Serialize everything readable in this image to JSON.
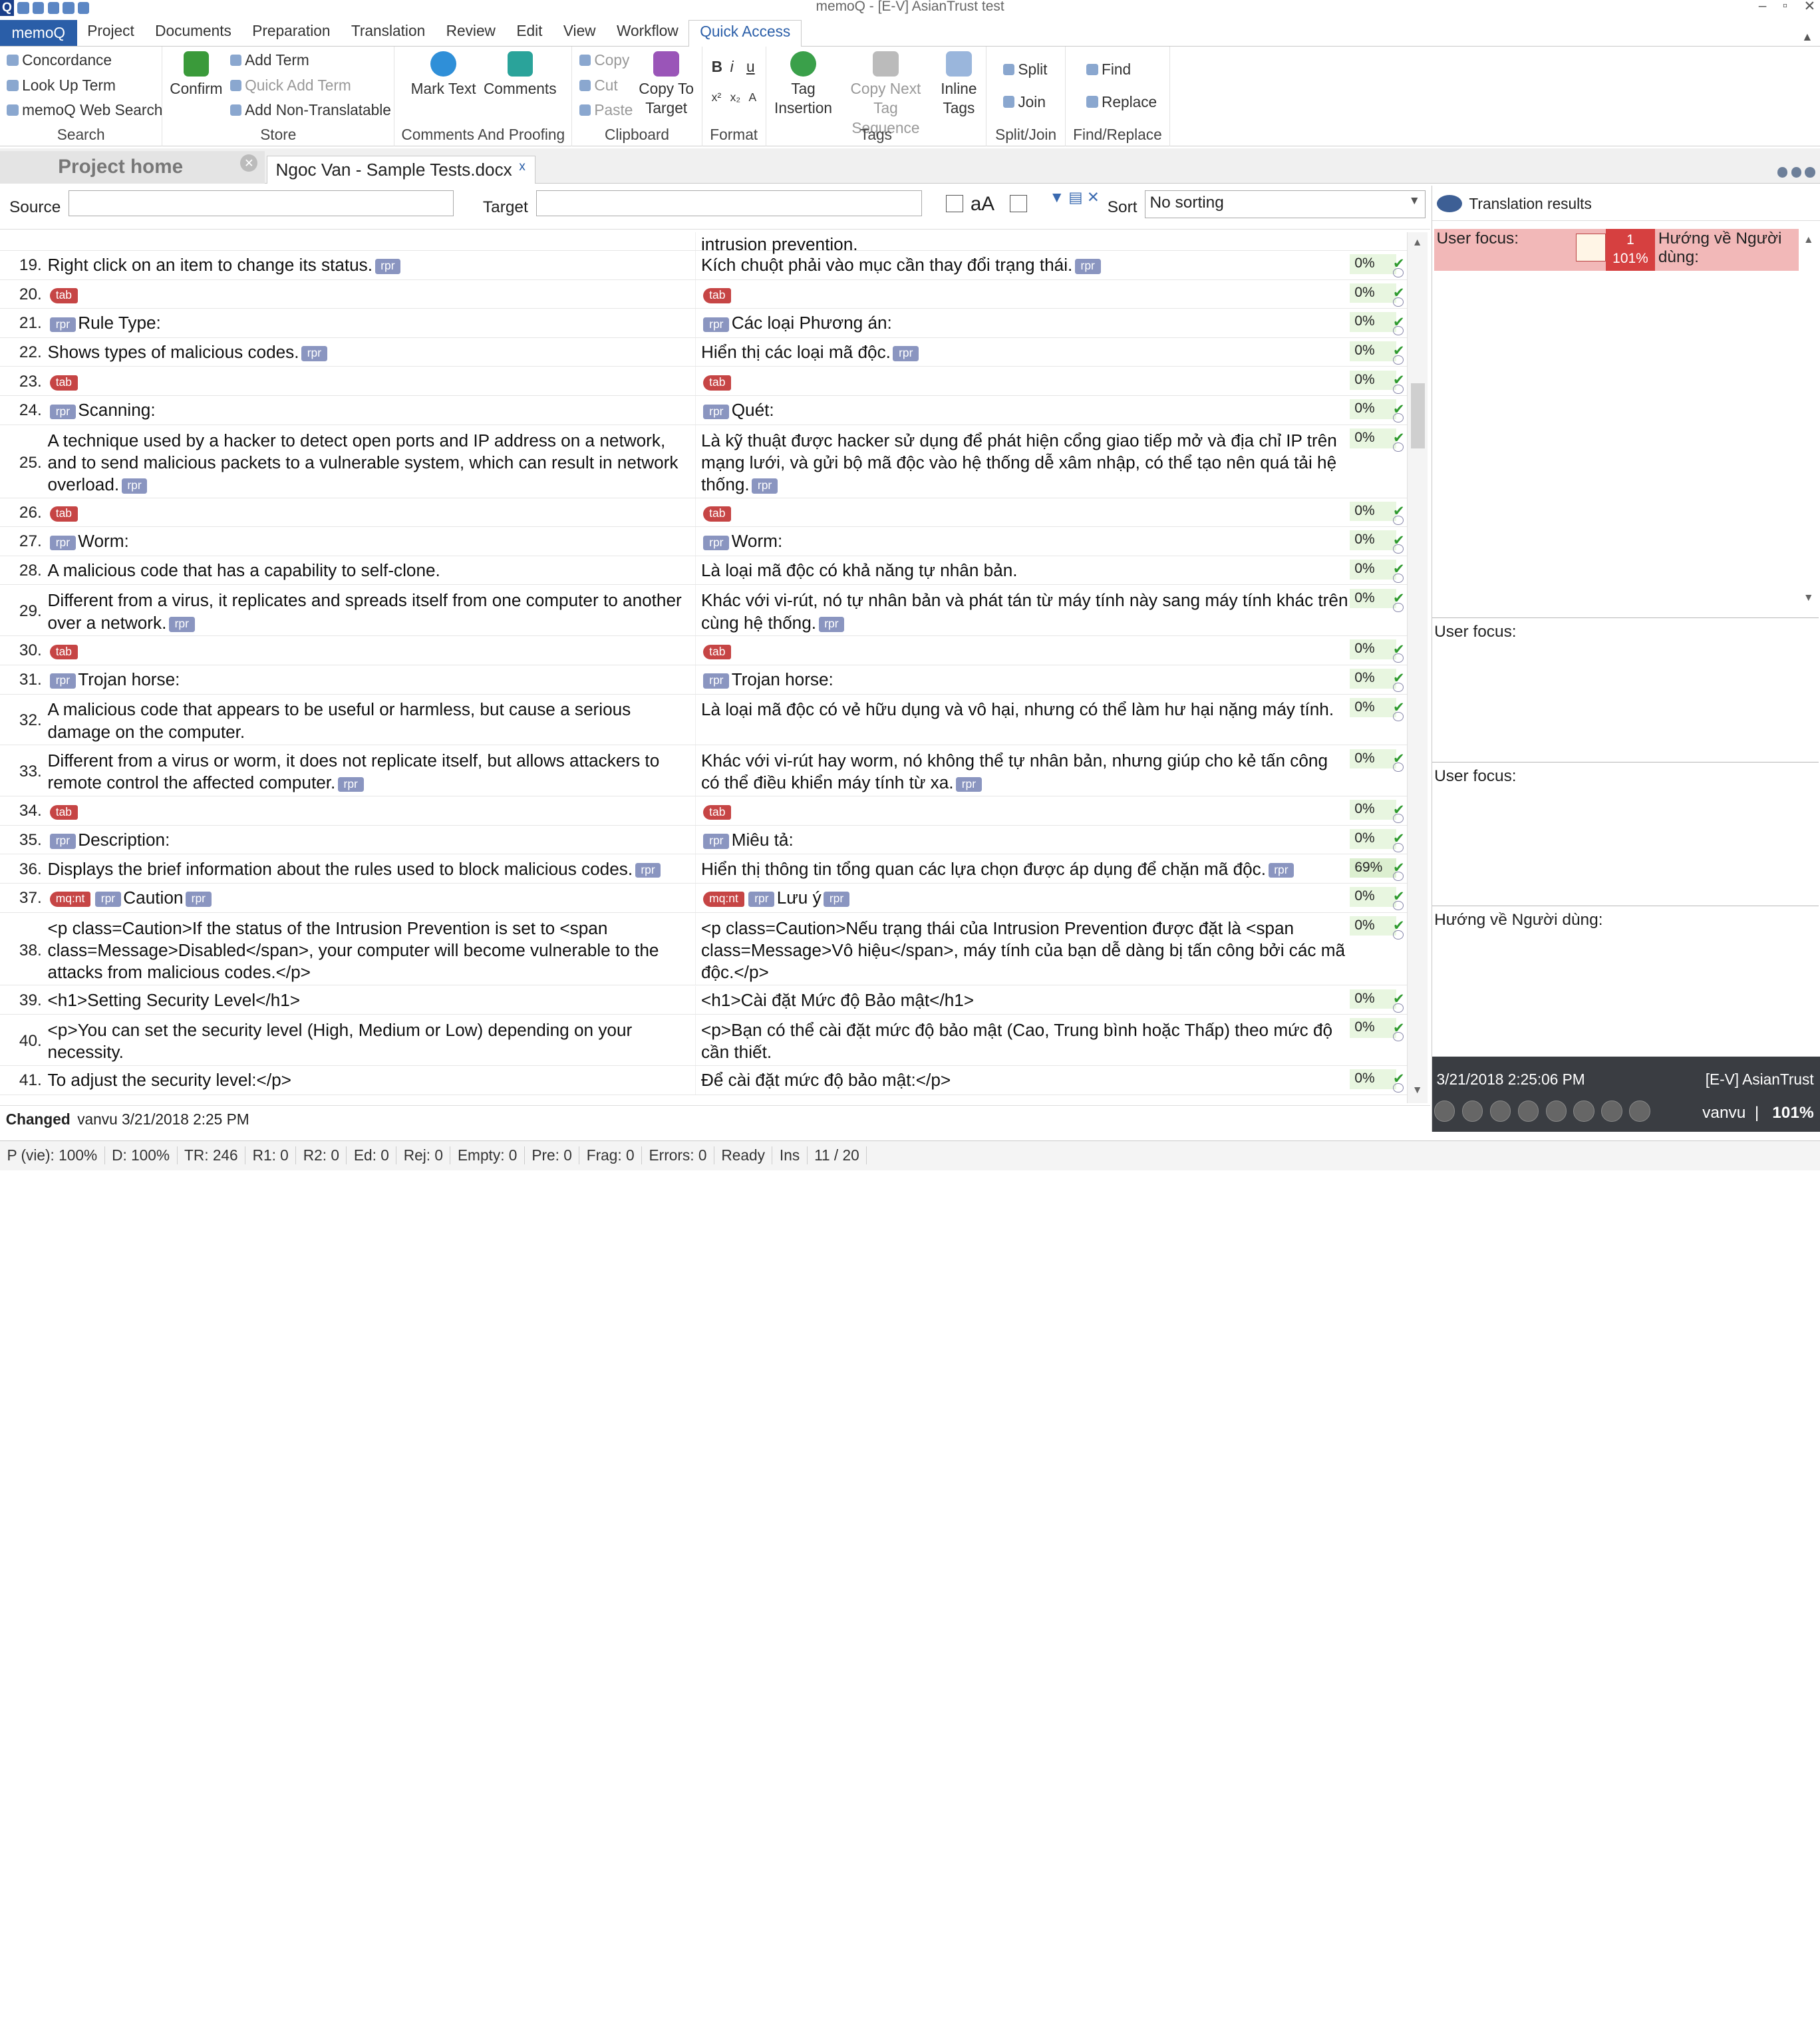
{
  "window": {
    "title": "memoQ - [E-V] AsianTrust test",
    "logo": "Q"
  },
  "menu": [
    "memoQ",
    "Project",
    "Documents",
    "Preparation",
    "Translation",
    "Review",
    "Edit",
    "View",
    "Workflow",
    "Quick Access"
  ],
  "ribbon": {
    "search": {
      "label": "Search",
      "items": [
        "Concordance",
        "Look Up Term",
        "memoQ Web Search"
      ]
    },
    "store": {
      "label": "Store",
      "confirm": "Confirm",
      "items": [
        "Add Term",
        "Quick Add Term",
        "Add Non-Translatable"
      ]
    },
    "comments": {
      "label": "Comments And Proofing",
      "mark_text": "Mark Text",
      "comments": "Comments"
    },
    "clipboard": {
      "label": "Clipboard",
      "items": [
        "Copy",
        "Cut",
        "Paste"
      ],
      "copy_to_target": "Copy To Target"
    },
    "format": {
      "label": "Format"
    },
    "tags": {
      "label": "Tags",
      "tag_insertion": "Tag Insertion",
      "copy_next": "Copy Next Tag Sequence",
      "inline_tags": "Inline Tags"
    },
    "splitjoin": {
      "label": "Split/Join",
      "split": "Split",
      "join": "Join"
    },
    "findreplace": {
      "label": "Find/Replace",
      "find": "Find",
      "replace": "Replace"
    }
  },
  "tabs": {
    "project_home": "Project home",
    "document": "Ngoc Van - Sample Tests.docx",
    "document_close": "x"
  },
  "filter": {
    "source_label": "Source",
    "target_label": "Target",
    "case_label": "aA",
    "sort_label": "Sort",
    "sort_value": "No sorting"
  },
  "rows": [
    {
      "n": "",
      "src": "",
      "tgt": "intrusion prevention.",
      "st": ""
    },
    {
      "n": "19.",
      "src": "Right click on an item to change its status.",
      "src_tags": [
        "rpr"
      ],
      "tgt": "Kích chuột phải vào mục cần thay đổi trạng thái.",
      "tgt_tags": [
        "rpr"
      ],
      "st": "0%"
    },
    {
      "n": "20.",
      "src": "",
      "pre": "tab",
      "tgt": "",
      "tpre": "tab",
      "st": "0%"
    },
    {
      "n": "21.",
      "src": "Rule Type:",
      "pre": "rpr",
      "tgt": "Các loại Phương án:",
      "tpre": "rpr",
      "st": "0%"
    },
    {
      "n": "22.",
      "src": "Shows types of malicious codes.",
      "src_tags": [
        "rpr"
      ],
      "tgt": "Hiển thị các loại mã độc.",
      "tgt_tags": [
        "rpr"
      ],
      "st": "0%"
    },
    {
      "n": "23.",
      "src": "",
      "pre": "tab",
      "tgt": "",
      "tpre": "tab",
      "st": "0%"
    },
    {
      "n": "24.",
      "src": "Scanning:",
      "pre": "rpr",
      "tgt": "Quét:",
      "tpre": "rpr",
      "st": "0%"
    },
    {
      "n": "25.",
      "src": "A technique used by a hacker to detect open ports and IP address on a network, and to send malicious packets to a vulnerable system, which can result in network overload.",
      "src_tags": [
        "rpr"
      ],
      "tgt": "Là kỹ thuật được hacker sử dụng để phát hiện cổng giao tiếp mở và địa chỉ IP trên mạng lưới, và gửi bộ mã độc vào hệ thống dễ xâm nhập, có thể tạo nên quá tải hệ thống.",
      "tgt_tags": [
        "rpr"
      ],
      "st": "0%"
    },
    {
      "n": "26.",
      "src": "",
      "pre": "tab",
      "tgt": "",
      "tpre": "tab",
      "st": "0%"
    },
    {
      "n": "27.",
      "src": "Worm:",
      "pre": "rpr",
      "tgt": "Worm:",
      "tpre": "rpr",
      "st": "0%"
    },
    {
      "n": "28.",
      "src": "A malicious code that has a capability to self-clone.",
      "tgt": "Là loại mã độc có khả năng tự nhân bản.",
      "st": "0%"
    },
    {
      "n": "29.",
      "src": "Different from a virus, it replicates and spreads itself from one computer to another over a network.",
      "src_tags": [
        "rpr"
      ],
      "tgt": "Khác với vi-rút, nó tự nhân bản và phát tán từ máy tính này sang máy tính khác trên cùng hệ thống.",
      "tgt_tags": [
        "rpr"
      ],
      "st": "0%"
    },
    {
      "n": "30.",
      "src": "",
      "pre": "tab",
      "tgt": "",
      "tpre": "tab",
      "st": "0%"
    },
    {
      "n": "31.",
      "src": "Trojan horse:",
      "pre": "rpr",
      "tgt": "Trojan horse:",
      "tpre": "rpr",
      "st": "0%"
    },
    {
      "n": "32.",
      "src": "A malicious code that appears to be useful or harmless, but cause a serious damage on the computer.",
      "tgt": "Là loại mã độc có vẻ hữu dụng và vô hại, nhưng có thể làm hư hại nặng máy tính.",
      "st": "0%"
    },
    {
      "n": "33.",
      "src": "Different from a virus or worm, it does not replicate itself, but allows attackers to remote control the affected computer.",
      "src_tags": [
        "rpr"
      ],
      "tgt": "Khác với vi-rút hay worm, nó không thể tự nhân bản, nhưng giúp cho kẻ tấn công có thể điều khiển máy tính từ xa.",
      "tgt_tags": [
        "rpr"
      ],
      "st": "0%"
    },
    {
      "n": "34.",
      "src": "",
      "pre": "tab",
      "tgt": "",
      "tpre": "tab",
      "st": "0%"
    },
    {
      "n": "35.",
      "src": "Description:",
      "pre": "rpr",
      "tgt": "Miêu tả:",
      "tpre": "rpr",
      "st": "0%"
    },
    {
      "n": "36.",
      "src": "Displays the brief information about the rules used to block malicious codes.",
      "src_tags": [
        "rpr"
      ],
      "tgt": "Hiển thị thông tin tổng quan các lựa chọn được áp dụng để chặn mã độc.",
      "tgt_tags": [
        "rpr"
      ],
      "st": "69%"
    },
    {
      "n": "37.",
      "src": "Caution",
      "pre": "mq:nt",
      "pre2": "rpr",
      "src_tags": [
        "rpr"
      ],
      "tgt": "Lưu ý",
      "tpre": "mq:nt",
      "tpre2": "rpr",
      "tgt_tags": [
        "rpr"
      ],
      "st": "0%"
    },
    {
      "n": "38.",
      "src": "<p class=Caution>If the status of the Intrusion Prevention is set to <span class=Message>Disabled</span>, your computer will become vulnerable to the attacks from malicious codes.</p>",
      "tgt": "<p class=Caution>Nếu trạng thái của Intrusion Prevention được đặt là <span class=Message>Vô hiệu</span>, máy tính của bạn dễ dàng bị tấn công bởi các mã độc.</p>",
      "st": "0%"
    },
    {
      "n": "39.",
      "src": "<h1>Setting Security Level</h1>",
      "tgt": "<h1>Cài đặt Mức độ Bảo mật</h1>",
      "st": "0%"
    },
    {
      "n": "40.",
      "src": "<p>You can set the security level (High, Medium or Low) depending on your necessity.",
      "tgt": "<p>Bạn có thể cài đặt mức độ bảo mật (Cao, Trung bình hoặc Thấp) theo mức độ cần thiết.",
      "st": "0%"
    },
    {
      "n": "41.",
      "src": "To adjust the security level:</p>",
      "tgt": "Để cài đặt mức độ bảo mật:</p>",
      "st": "0%"
    }
  ],
  "results": {
    "title": "Translation results",
    "match_src": "User focus:",
    "match_num": "1",
    "match_pct": "101%",
    "match_tgt": "Hướng về Người dùng:",
    "pane1": "User focus:",
    "pane2": "User focus:",
    "pane3": "Hướng về Người dùng:",
    "foot_date": "3/21/2018 2:25:06 PM",
    "foot_project": "[E-V] AsianTrust",
    "foot_user": "vanvu",
    "foot_sep": "|",
    "foot_pct": "101%"
  },
  "changed": {
    "label": "Changed",
    "value": "vanvu 3/21/2018 2:25 PM"
  },
  "status": [
    "P (vie): 100%",
    "D: 100%",
    "TR: 246",
    "R1: 0",
    "R2: 0",
    "Ed: 0",
    "Rej: 0",
    "Empty: 0",
    "Pre: 0",
    "Frag: 0",
    "Errors: 0",
    "Ready",
    "Ins",
    "11 / 20"
  ]
}
